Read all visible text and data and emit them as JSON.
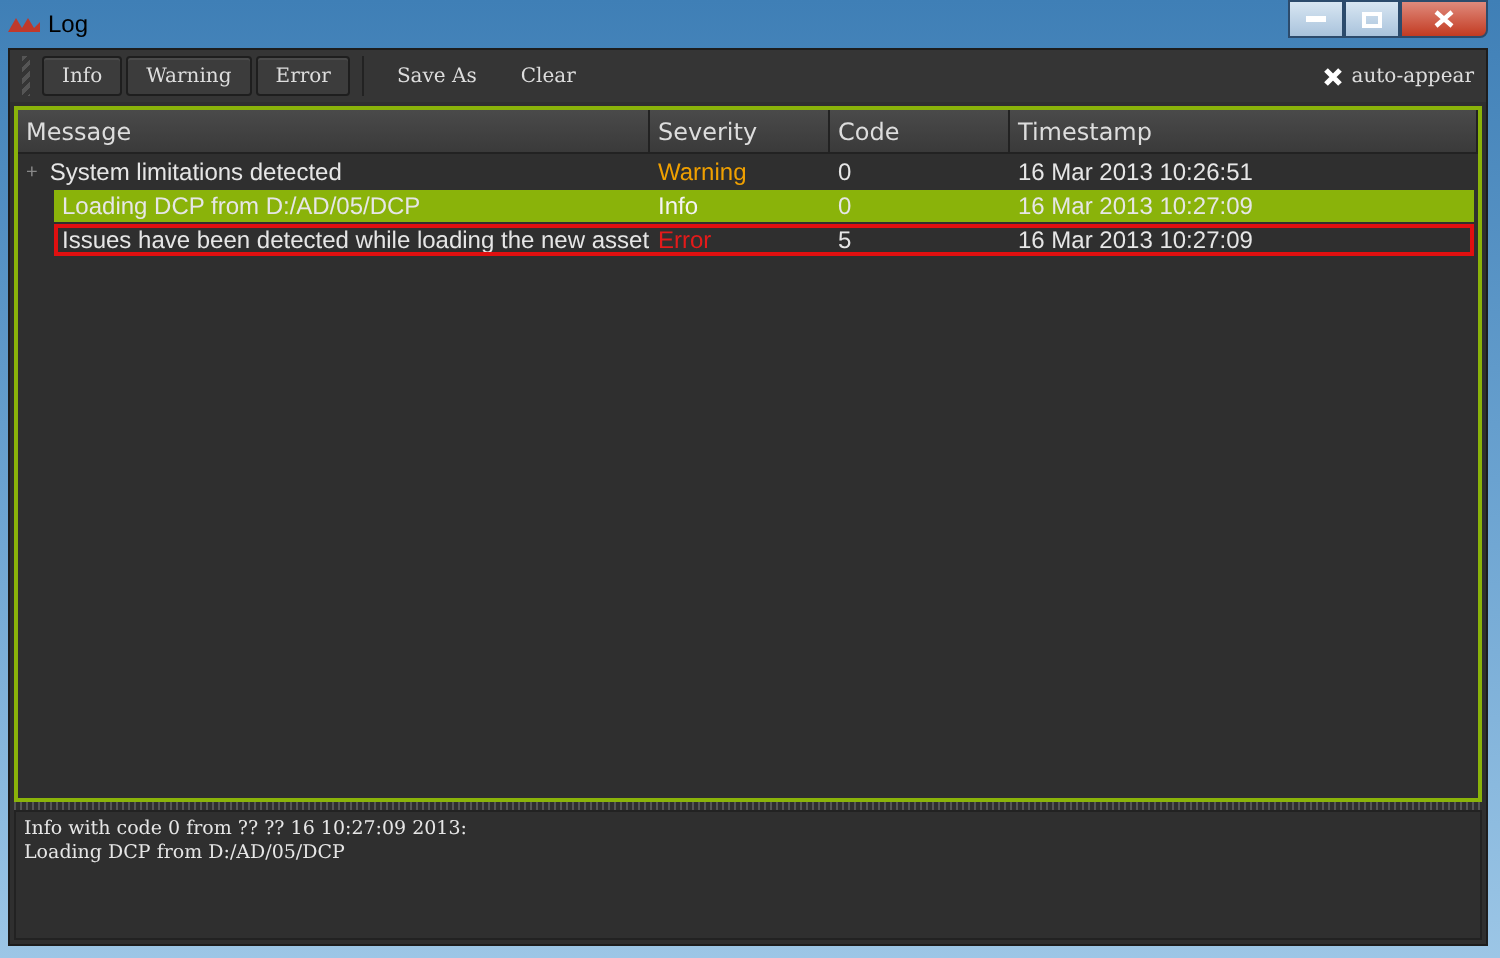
{
  "window": {
    "title": "Log"
  },
  "toolbar": {
    "buttons": [
      {
        "label": "Info",
        "kind": "toggle"
      },
      {
        "label": "Warning",
        "kind": "toggle"
      },
      {
        "label": "Error",
        "kind": "toggle"
      },
      {
        "label": "Save As",
        "kind": "action"
      },
      {
        "label": "Clear",
        "kind": "action"
      }
    ],
    "auto_appear": {
      "label": "auto-appear",
      "checked": true
    }
  },
  "table": {
    "columns": [
      "Message",
      "Severity",
      "Code",
      "Timestamp"
    ],
    "rows": [
      {
        "message": "System limitations detected",
        "severity": "Warning",
        "kind": "warning",
        "code": "0",
        "timestamp": "16 Mar 2013 10:26:51",
        "expander": "+",
        "selected": false,
        "flagged": false
      },
      {
        "message": "Loading DCP from D:/AD/05/DCP",
        "severity": "Info",
        "kind": "info",
        "code": "0",
        "timestamp": "16 Mar 2013 10:27:09",
        "selected": true,
        "flagged": false
      },
      {
        "message": "Issues have been detected while loading the new asset",
        "severity": "Error",
        "kind": "error",
        "code": "5",
        "timestamp": "16 Mar 2013 10:27:09",
        "selected": false,
        "flagged": true
      }
    ]
  },
  "details": [
    "Info with code 0 from ?? ?? 16 10:27:09 2013:",
    "Loading DCP from D:/AD/05/DCP"
  ]
}
